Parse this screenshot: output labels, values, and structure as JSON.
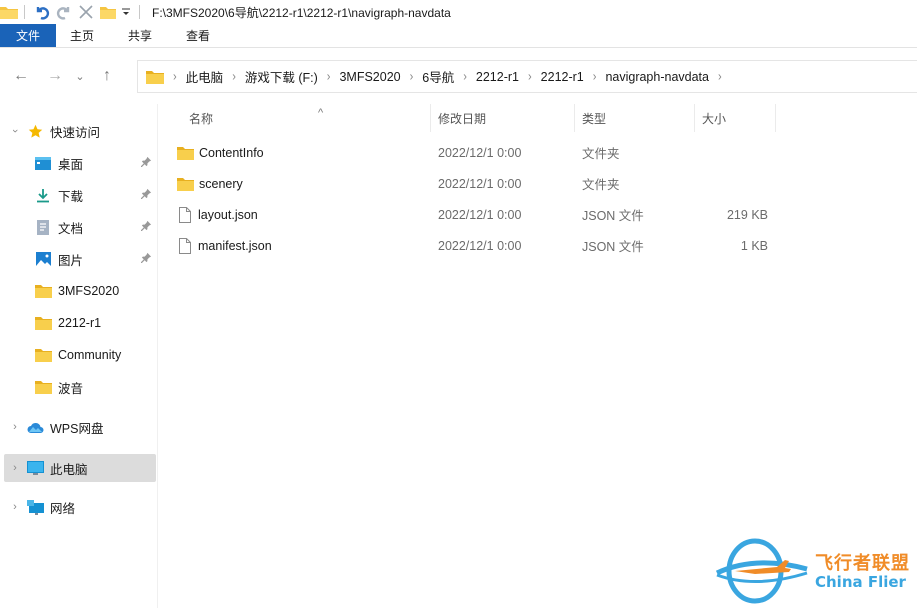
{
  "window": {
    "title_path": "F:\\3MFS2020\\6导航\\2212-r1\\2212-r1\\navigraph-navdata",
    "quick_access_toolbar": [
      "folder-icon",
      "undo-icon",
      "redo-icon",
      "delete-icon",
      "new-folder-icon",
      "customize-dropdown-icon"
    ]
  },
  "ribbon": {
    "tabs": [
      {
        "label": "文件",
        "active": true
      },
      {
        "label": "主页"
      },
      {
        "label": "共享"
      },
      {
        "label": "查看"
      }
    ]
  },
  "navigation": {
    "back": "←",
    "forward": "→",
    "recent": "⌄",
    "up": "↑",
    "breadcrumb": [
      "此电脑",
      "游戏下载 (F:)",
      "3MFS2020",
      "6导航",
      "2212-r1",
      "2212-r1",
      "navigraph-navdata"
    ]
  },
  "sidebar": {
    "quick_access": {
      "label": "快速访问",
      "expanded": true
    },
    "pinned": [
      {
        "label": "桌面",
        "icon": "desktop-icon"
      },
      {
        "label": "下载",
        "icon": "download-icon"
      },
      {
        "label": "文档",
        "icon": "documents-icon"
      },
      {
        "label": "图片",
        "icon": "pictures-icon"
      }
    ],
    "folders": [
      {
        "label": "3MFS2020"
      },
      {
        "label": "2212-r1"
      },
      {
        "label": "Community"
      },
      {
        "label": "波音"
      }
    ],
    "roots": [
      {
        "label": "WPS网盘",
        "icon": "cloud-icon"
      },
      {
        "label": "此电脑",
        "icon": "computer-icon",
        "selected": true
      },
      {
        "label": "网络",
        "icon": "network-icon"
      }
    ]
  },
  "file_list": {
    "columns": {
      "name": "名称",
      "modified": "修改日期",
      "type": "类型",
      "size": "大小"
    },
    "sort_indicator": "^",
    "rows": [
      {
        "name": "ContentInfo",
        "modified": "2022/12/1 0:00",
        "type": "文件夹",
        "size": "",
        "kind": "folder"
      },
      {
        "name": "scenery",
        "modified": "2022/12/1 0:00",
        "type": "文件夹",
        "size": "",
        "kind": "folder"
      },
      {
        "name": "layout.json",
        "modified": "2022/12/1 0:00",
        "type": "JSON 文件",
        "size": "219 KB",
        "kind": "file"
      },
      {
        "name": "manifest.json",
        "modified": "2022/12/1 0:00",
        "type": "JSON 文件",
        "size": "1 KB",
        "kind": "file"
      }
    ]
  },
  "watermark": {
    "cn": "飞行者联盟",
    "en": "China Flier"
  },
  "colors": {
    "accent": "#1a63b8",
    "folder": "#f5c542",
    "selection": "#dcdcdc",
    "watermark_orange": "#f08c28",
    "watermark_blue": "#3aa6e0"
  }
}
